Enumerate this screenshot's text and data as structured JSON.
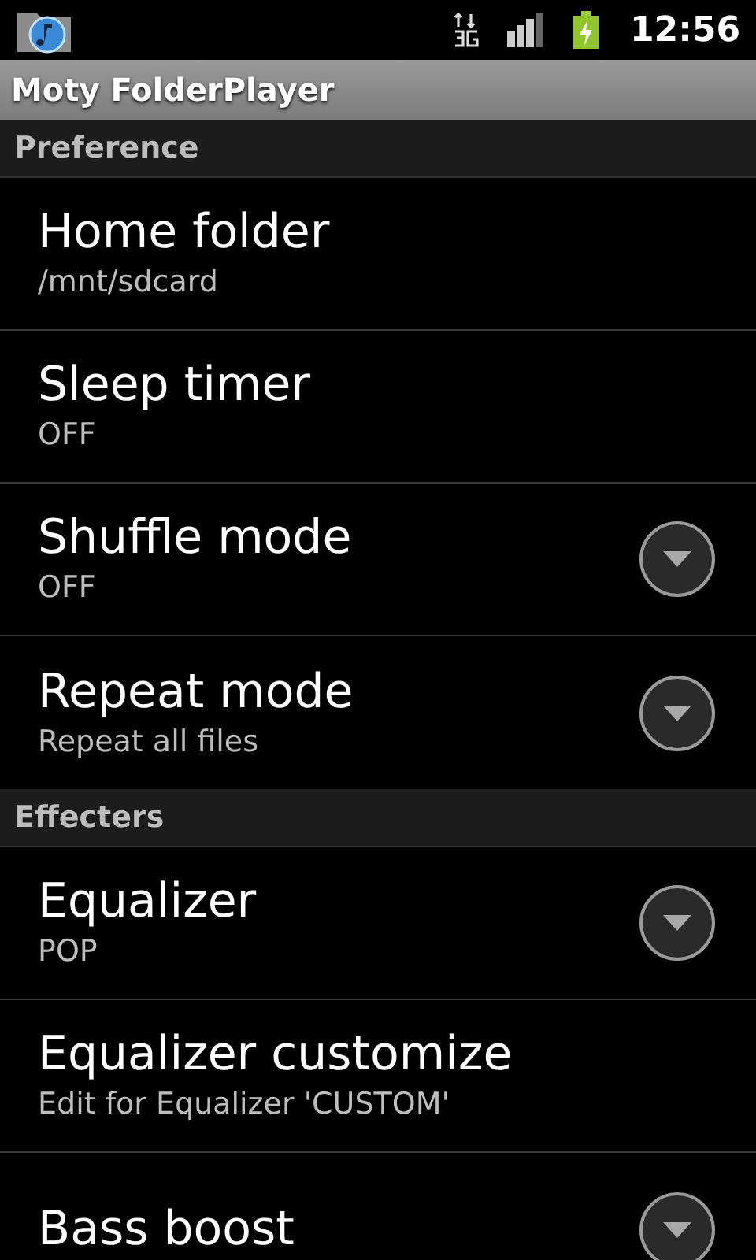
{
  "status_bar": {
    "time": "12:56"
  },
  "app_bar": {
    "title": "Moty FolderPlayer"
  },
  "sections": [
    {
      "header": "Preference",
      "items": [
        {
          "kind": "plain",
          "title": "Home folder",
          "summary": "/mnt/sdcard"
        },
        {
          "kind": "plain",
          "title": "Sleep timer",
          "summary": "OFF"
        },
        {
          "kind": "dropdown",
          "title": "Shuffle mode",
          "summary": "OFF"
        },
        {
          "kind": "dropdown",
          "title": "Repeat mode",
          "summary": "Repeat all files"
        }
      ]
    },
    {
      "header": "Effecters",
      "items": [
        {
          "kind": "dropdown",
          "title": "Equalizer",
          "summary": "POP"
        },
        {
          "kind": "plain",
          "title": "Equalizer customize",
          "summary": "Edit for Equalizer 'CUSTOM'"
        },
        {
          "kind": "dropdown",
          "title": "Bass boost"
        }
      ]
    }
  ]
}
